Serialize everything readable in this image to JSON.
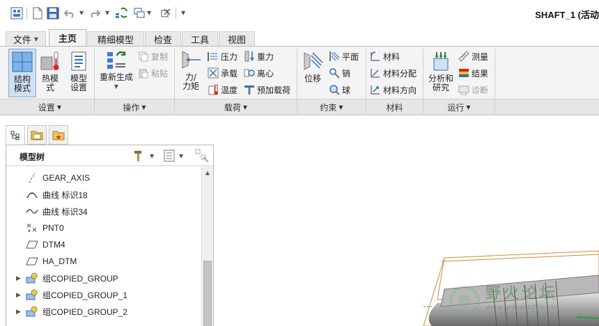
{
  "window": {
    "title": "SHAFT_1 (活动"
  },
  "quick_access": {
    "icons": [
      "window-icon",
      "new-icon",
      "open-icon",
      "save-icon",
      "undo-icon",
      "redo-icon",
      "regenerate-icon",
      "windows-icon",
      "close-window-icon",
      "customize-icon"
    ]
  },
  "tabs": [
    {
      "label": "文件",
      "has_menu": true
    },
    {
      "label": "主页",
      "active": true
    },
    {
      "label": "精细模型"
    },
    {
      "label": "检查"
    },
    {
      "label": "工具"
    },
    {
      "label": "视图"
    }
  ],
  "ribbon": {
    "groups": {
      "setup": {
        "label": "设置",
        "structure_model": "结构\n模式",
        "thermal_model": "热模\n式",
        "model_setup": "模型\n设置"
      },
      "operations": {
        "label": "操作",
        "regenerate": "重新生成",
        "copy": "复制",
        "paste": "粘贴"
      },
      "loads": {
        "label": "载荷",
        "force_moment": "力/\n力矩",
        "pressure": "压力",
        "bearing": "承载",
        "temperature": "温度",
        "gravity": "重力",
        "centrifugal": "离心",
        "preload": "预加载荷"
      },
      "constraints": {
        "label": "约束",
        "displacement": "位移",
        "plane": "平面",
        "pin": "销",
        "ball": "球"
      },
      "materials": {
        "label": "材料",
        "material": "材料",
        "material_assignment": "材料分配",
        "material_orientation": "材料方向"
      },
      "run": {
        "label": "运行",
        "analysis": "分析和\n研究",
        "measure": "测量",
        "results": "结果",
        "diagnostics": "诊断"
      }
    }
  },
  "model_tree": {
    "title": "模型树",
    "items": [
      {
        "label": "GEAR_AXIS",
        "icon": "axis-icon",
        "expandable": false
      },
      {
        "label": "曲线 标识18",
        "icon": "curve-icon",
        "expandable": false
      },
      {
        "label": "曲线 标识34",
        "icon": "curve-wave-icon",
        "expandable": false
      },
      {
        "label": "PNT0",
        "icon": "datum-point-icon",
        "expandable": false
      },
      {
        "label": "DTM4",
        "icon": "datum-plane-icon",
        "expandable": false
      },
      {
        "label": "HA_DTM",
        "icon": "datum-plane-icon",
        "expandable": false
      },
      {
        "label": "组COPIED_GROUP",
        "icon": "group-icon",
        "expandable": true
      },
      {
        "label": "组COPIED_GROUP_1",
        "icon": "group-icon",
        "expandable": true
      },
      {
        "label": "组COPIED_GROUP_2",
        "icon": "group-icon",
        "expandable": true
      }
    ]
  },
  "watermark": {
    "text": "野火论坛",
    "subtext": "www.proewildfire.cn"
  },
  "colors": {
    "accent_blue": "#2d6fb8",
    "pressed_bg": "#cfe0f3",
    "ribbon_bg": "#f4f4f4"
  }
}
